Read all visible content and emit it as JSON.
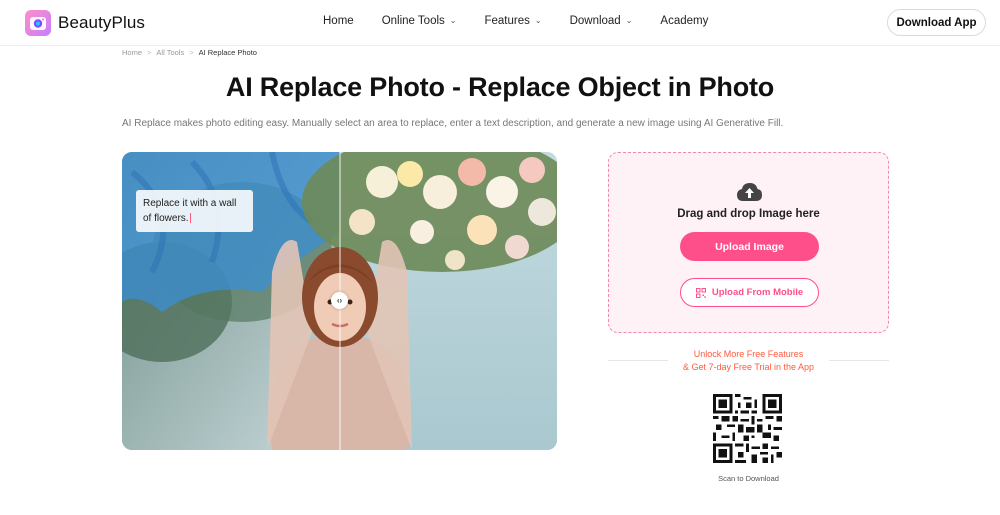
{
  "brand": {
    "name": "BeautyPlus"
  },
  "nav": {
    "home": "Home",
    "online_tools": "Online Tools",
    "features": "Features",
    "download": "Download",
    "academy": "Academy"
  },
  "header": {
    "download_app": "Download App"
  },
  "breadcrumb": {
    "home": "Home",
    "all_tools": "All Tools",
    "current": "AI Replace Photo",
    "sep": ">"
  },
  "main": {
    "title": "AI Replace Photo - Replace Object in Photo",
    "subtitle": "AI Replace makes photo editing easy. Manually select an area to replace, enter a text description, and generate a new image using AI Generative Fill."
  },
  "demo": {
    "prompt_line1": "Replace it with a wall",
    "prompt_line2": "of flowers."
  },
  "upload": {
    "drop_text": "Drag and drop Image here",
    "upload_image": "Upload Image",
    "upload_mobile": "Upload From Mobile"
  },
  "promo": {
    "line1": "Unlock More Free Features",
    "line2": "& Get 7-day Free Trial in the App",
    "scan": "Scan to Download"
  },
  "colors": {
    "accent": "#ff4f8b",
    "promo": "#ff5a3c",
    "upload_bg": "#fff2f6"
  },
  "icons": {
    "logo": "beautyplus-logo-icon",
    "chevron": "chevron-down-icon",
    "cloud": "cloud-upload-icon",
    "qr": "qr-icon"
  }
}
